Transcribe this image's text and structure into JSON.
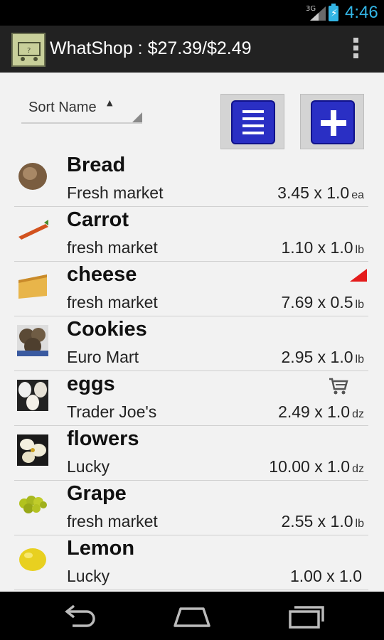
{
  "status_bar": {
    "network": "3G",
    "time": "4:46"
  },
  "action_bar": {
    "title": "WhatShop : $27.39/$2.49",
    "menu_icon": "overflow-menu-icon"
  },
  "sort": {
    "label": "Sort Name",
    "caret": "▲"
  },
  "buttons": {
    "list_icon": "list-icon",
    "add_icon": "plus-icon"
  },
  "items": [
    {
      "name": "Bread",
      "store": "Fresh market",
      "price": "3.45 x 1.0",
      "unit": "ea",
      "thumb_color": "#8a6a4a"
    },
    {
      "name": "Carrot",
      "store": "fresh market",
      "price": "1.10 x 1.0",
      "unit": "lb",
      "thumb_color": "#d2521e"
    },
    {
      "name": "cheese",
      "store": "fresh market",
      "price": "7.69 x 0.5",
      "unit": "lb",
      "thumb_color": "#e8b54a",
      "flag": true
    },
    {
      "name": "Cookies",
      "store": "Euro Mart",
      "price": "2.95 x 1.0",
      "unit": "lb",
      "thumb_color": "#6b5a44"
    },
    {
      "name": "eggs",
      "store": "Trader Joe's",
      "price": "2.49 x 1.0",
      "unit": "dz",
      "thumb_color": "#e6e1d6",
      "in_cart": true
    },
    {
      "name": "flowers",
      "store": "Lucky",
      "price": "10.00 x 1.0",
      "unit": "dz",
      "thumb_color": "#f0ecd8"
    },
    {
      "name": "Grape",
      "store": "fresh market",
      "price": "2.55 x 1.0",
      "unit": "lb",
      "thumb_color": "#a8b820"
    },
    {
      "name": "Lemon",
      "store": "Lucky",
      "price": "1.00 x 1.0",
      "unit": "",
      "thumb_color": "#e8d020"
    }
  ],
  "nav": {
    "back_icon": "back-icon",
    "home_icon": "home-icon",
    "recents_icon": "recents-icon"
  }
}
